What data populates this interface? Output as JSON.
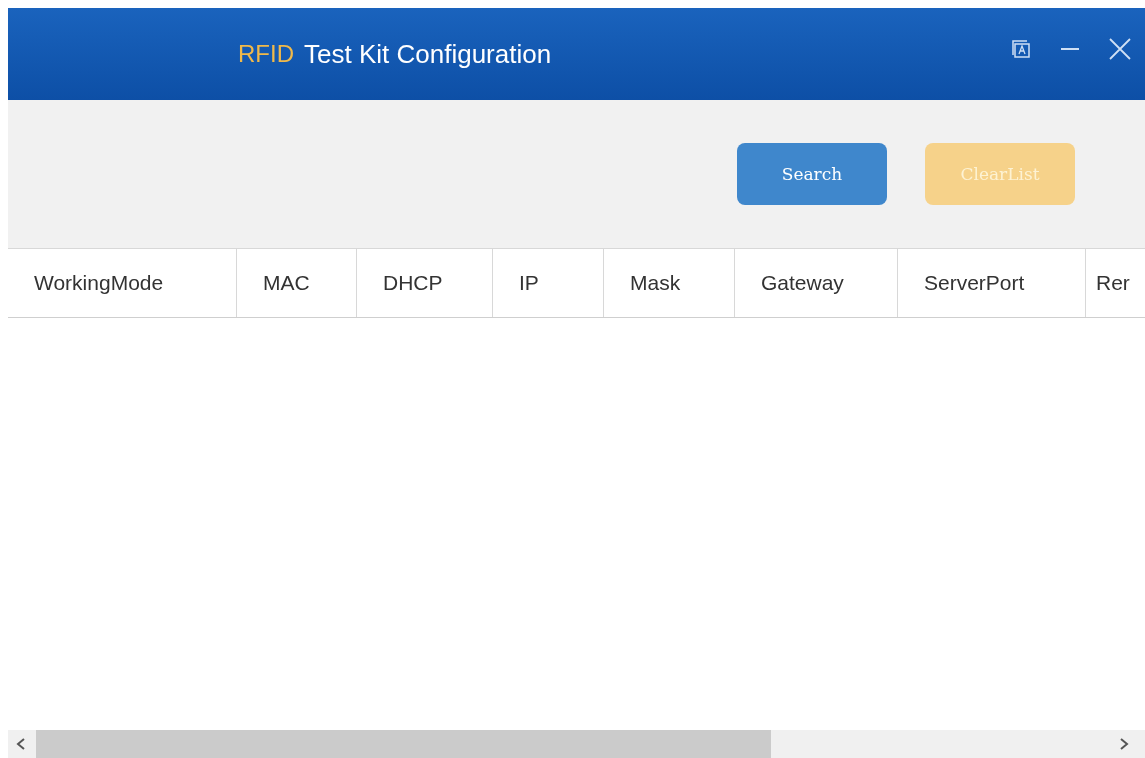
{
  "window": {
    "title_prefix": "RFID",
    "title": "Test Kit Configuration"
  },
  "toolbar": {
    "buttons": [
      {
        "label": "Search",
        "kind": "primary",
        "disabled": false
      },
      {
        "label": "ClearList",
        "kind": "warning",
        "disabled": true
      }
    ]
  },
  "table": {
    "columns": [
      {
        "label": "WorkingMode"
      },
      {
        "label": "MAC"
      },
      {
        "label": "DHCP"
      },
      {
        "label": "IP"
      },
      {
        "label": "Mask"
      },
      {
        "label": "Gateway"
      },
      {
        "label": "ServerPort"
      },
      {
        "label": "Rer"
      }
    ]
  }
}
